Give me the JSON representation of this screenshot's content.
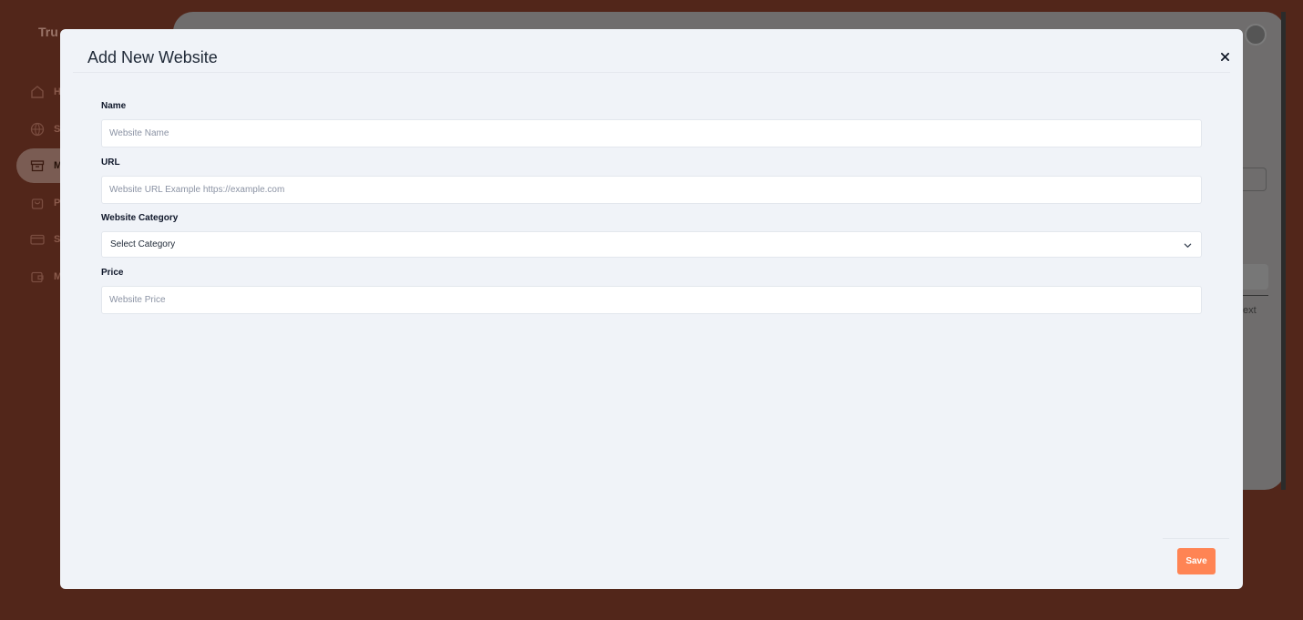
{
  "background": {
    "brand_partial": "Tru",
    "nav_items": [
      "H",
      "S",
      "M",
      "P",
      "S",
      "M"
    ],
    "text_partial": "ext"
  },
  "modal": {
    "title": "Add New Website",
    "close_icon": "close-icon",
    "fields": {
      "name": {
        "label": "Name",
        "placeholder": "Website Name",
        "value": ""
      },
      "url": {
        "label": "URL",
        "placeholder": "Website URL Example https://example.com",
        "value": ""
      },
      "category": {
        "label": "Website Category",
        "selected": "Select Category"
      },
      "price": {
        "label": "Price",
        "placeholder": "Website Price",
        "value": ""
      }
    },
    "save_label": "Save"
  },
  "colors": {
    "overlay": "#52261a",
    "modal_bg": "#f0f3f8",
    "accent": "#ff8454"
  }
}
